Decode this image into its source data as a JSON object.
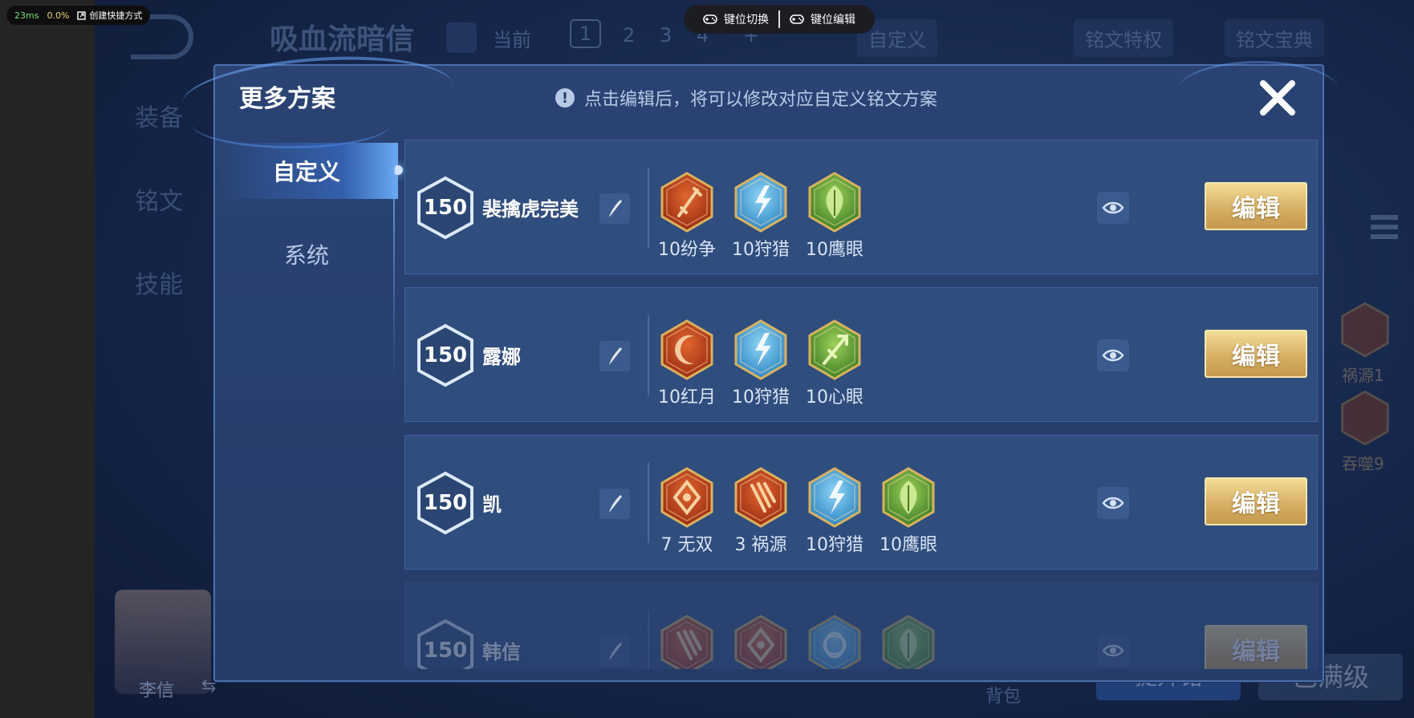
{
  "perf_overlay": {
    "latency": "23ms",
    "percent": "0.0%",
    "shortcut_label": "创建快捷方式"
  },
  "key_toolbar": {
    "switch_label": "键位切换",
    "edit_label": "键位编辑"
  },
  "background": {
    "title": "吸血流暗信",
    "current_label": "当前",
    "pages": [
      "1",
      "2",
      "3",
      "4",
      "+"
    ],
    "custom_tab": "自定义",
    "privilege_button": "铭文特权",
    "codex_button": "铭文宝典",
    "side_tabs": [
      "装备",
      "铭文",
      "技能"
    ],
    "hero_name": "李信",
    "swap_icon": "⇆",
    "bag_label": "背包",
    "button_left": "提升铭",
    "button_right": "已满级",
    "side_runes": [
      {
        "label": "祸源1",
        "color": "#c0512a"
      },
      {
        "label": "吞噬9",
        "color": "#c0512a"
      }
    ]
  },
  "modal": {
    "title": "更多方案",
    "notice": "点击编辑后，将可以修改对应自定义铭文方案",
    "tabs": [
      {
        "label": "自定义",
        "active": true
      },
      {
        "label": "系统",
        "active": false
      }
    ],
    "plans": [
      {
        "level": "150",
        "name": "裴擒虎完美",
        "runes": [
          {
            "label": "10纷争",
            "color": "red",
            "glyph": "sword"
          },
          {
            "label": "10狩猎",
            "color": "blue",
            "glyph": "bolt"
          },
          {
            "label": "10鹰眼",
            "color": "green",
            "glyph": "leaf"
          }
        ],
        "edit_label": "编辑"
      },
      {
        "level": "150",
        "name": "露娜",
        "runes": [
          {
            "label": "10红月",
            "color": "red",
            "glyph": "moon"
          },
          {
            "label": "10狩猎",
            "color": "blue",
            "glyph": "bolt"
          },
          {
            "label": "10心眼",
            "color": "green",
            "glyph": "arrow"
          }
        ],
        "edit_label": "编辑"
      },
      {
        "level": "150",
        "name": "凯",
        "runes": [
          {
            "label": "7 无双",
            "color": "red",
            "glyph": "diamond"
          },
          {
            "label": "3 祸源",
            "color": "red",
            "glyph": "claw"
          },
          {
            "label": "10狩猎",
            "color": "blue",
            "glyph": "bolt"
          },
          {
            "label": "10鹰眼",
            "color": "green",
            "glyph": "leaf"
          }
        ],
        "edit_label": "编辑"
      },
      {
        "level": "150",
        "name": "韩信",
        "runes": [
          {
            "label": "",
            "color": "red",
            "glyph": "claw"
          },
          {
            "label": "",
            "color": "red",
            "glyph": "diamond"
          },
          {
            "label": "",
            "color": "blue",
            "glyph": "knot"
          },
          {
            "label": "",
            "color": "green",
            "glyph": "leaf"
          }
        ],
        "edit_label": "编辑"
      }
    ]
  },
  "colors": {
    "rune_red": "#c8451f",
    "rune_blue": "#3d9fd6",
    "rune_green": "#5d9b33",
    "gold_border": "#d9b25e",
    "edit_button": "#d7b065",
    "modal_bg": "#2a4373"
  }
}
